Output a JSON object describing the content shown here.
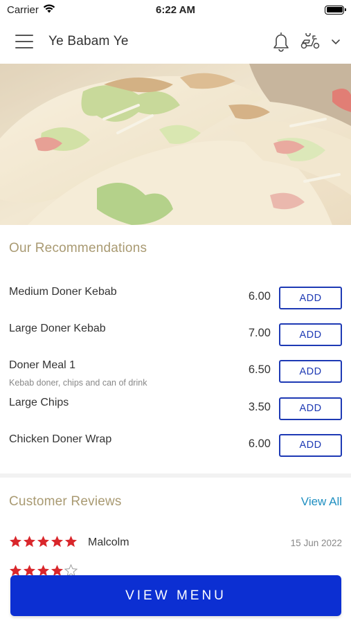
{
  "status_bar": {
    "carrier": "Carrier",
    "time": "6:22 AM"
  },
  "header": {
    "title": "Ye Babam Ye",
    "icons": [
      "menu-icon",
      "bell-icon",
      "scooter-icon",
      "chevron-down-icon"
    ]
  },
  "recommendations": {
    "title": "Our Recommendations",
    "add_label": "ADD",
    "items": [
      {
        "name": "Medium Doner Kebab",
        "description": "",
        "price": "6.00"
      },
      {
        "name": "Large Doner Kebab",
        "description": "",
        "price": "7.00"
      },
      {
        "name": "Doner Meal 1",
        "description": "Kebab doner, chips and can of drink",
        "price": "6.50"
      },
      {
        "name": "Large Chips",
        "description": "",
        "price": "3.50"
      },
      {
        "name": "Chicken Doner Wrap",
        "description": "",
        "price": "6.00"
      }
    ]
  },
  "reviews": {
    "title": "Customer Reviews",
    "view_all": "View All",
    "items": [
      {
        "reviewer": "Malcolm",
        "date": "15 Jun 2022",
        "rating": 5
      }
    ]
  },
  "footer": {
    "button_label": "VIEW MENU"
  },
  "colors": {
    "accent_blue": "#0c2fd2",
    "add_border": "#1d39b4",
    "section_title": "#a99a72",
    "link": "#1f8fc1",
    "star": "#d9262b"
  }
}
